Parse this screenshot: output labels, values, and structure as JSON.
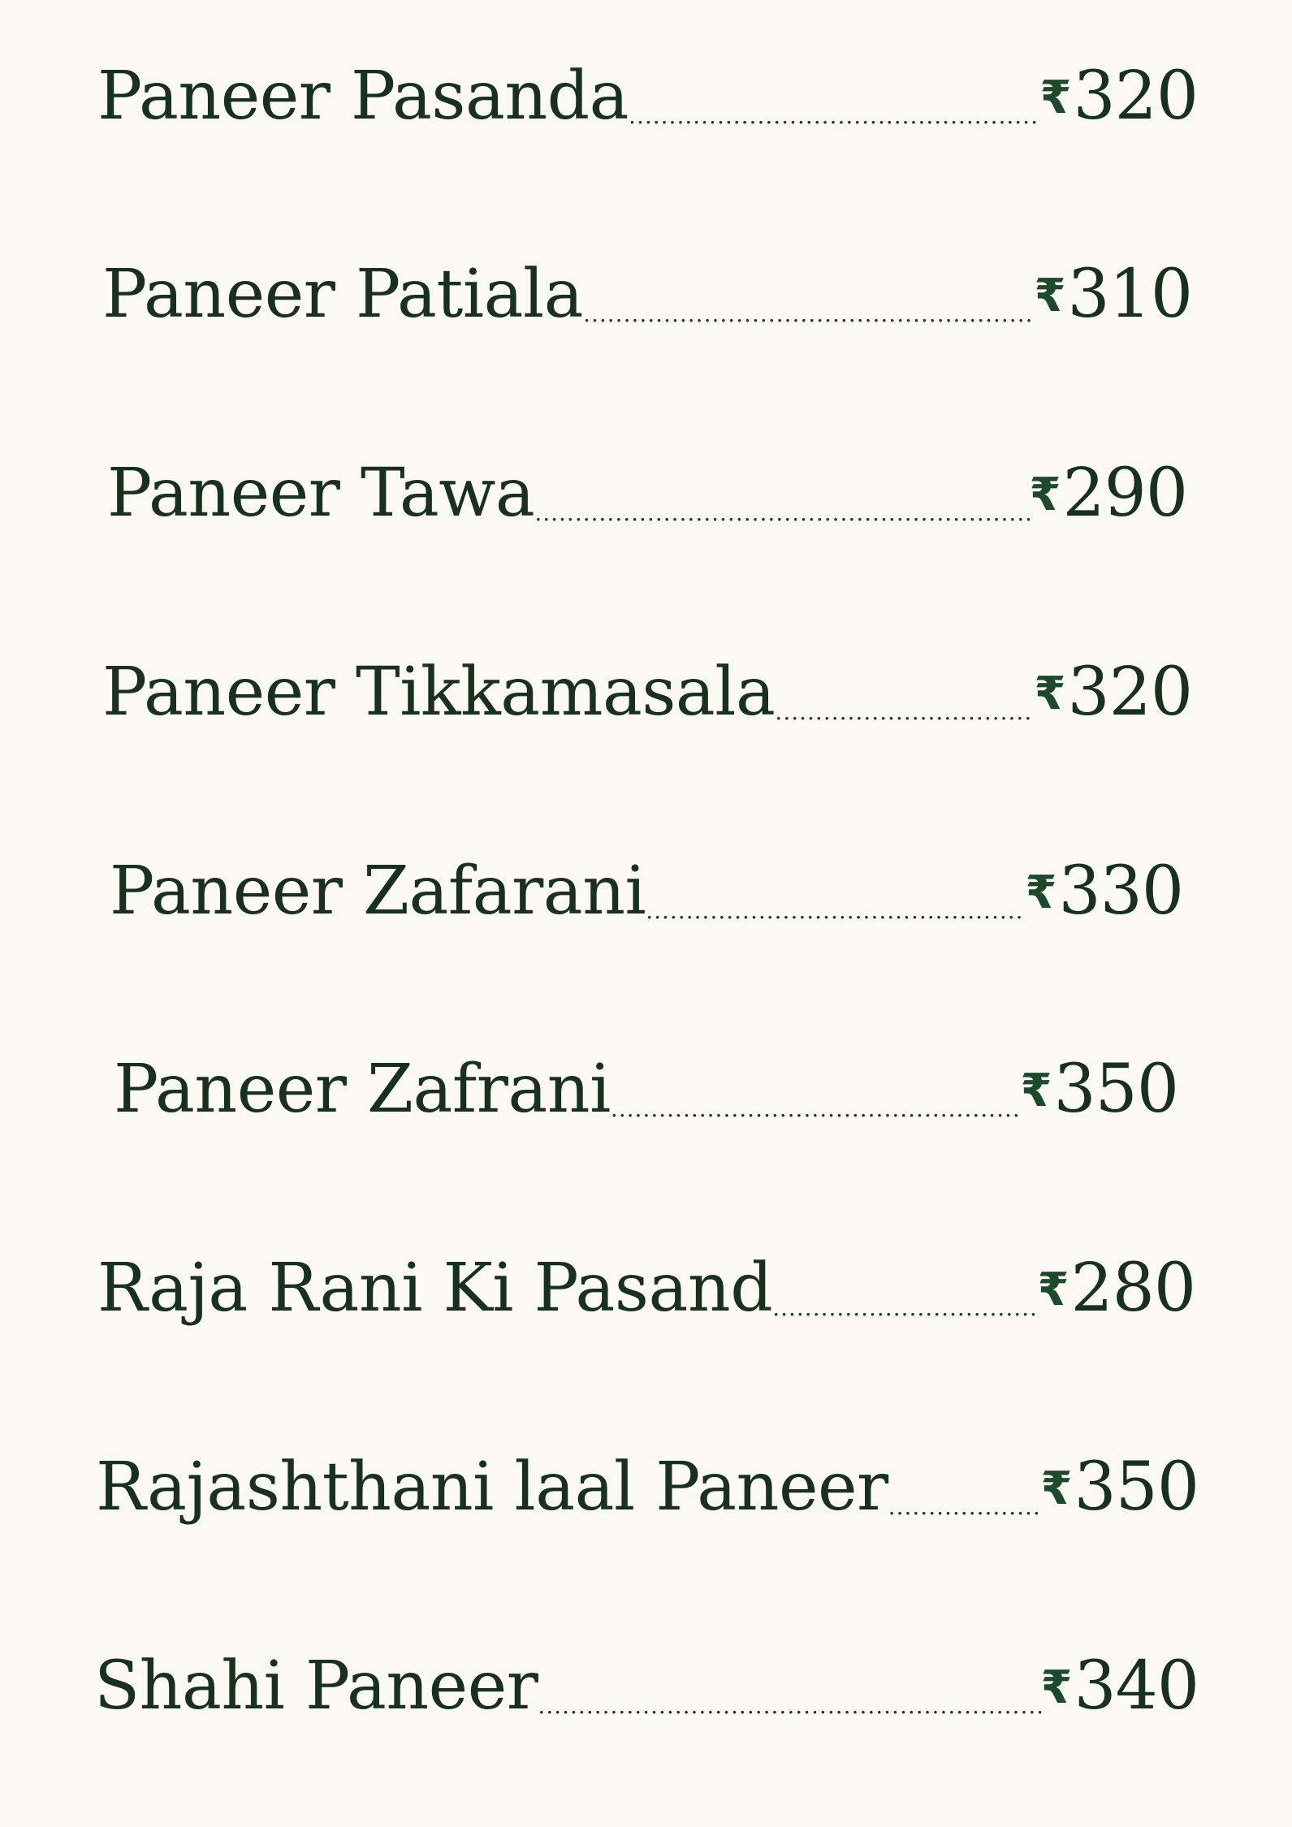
{
  "currency_symbol": "₹",
  "colors": {
    "background": "#fcf9f4",
    "text": "#17301f",
    "rupee": "#1d4a2d"
  },
  "items": [
    {
      "name": "Paneer Pasanda",
      "price": "320"
    },
    {
      "name": "Paneer Patiala",
      "price": "310"
    },
    {
      "name": "Paneer Tawa",
      "price": "290"
    },
    {
      "name": "Paneer Tikkamasala",
      "price": "320"
    },
    {
      "name": "Paneer Zafarani",
      "price": "330"
    },
    {
      "name": "Paneer Zafrani",
      "price": "350"
    },
    {
      "name": "Raja Rani Ki Pasand",
      "price": "280"
    },
    {
      "name": "Rajashthani laal Paneer",
      "price": "350"
    },
    {
      "name": "Shahi Paneer",
      "price": "340"
    }
  ]
}
